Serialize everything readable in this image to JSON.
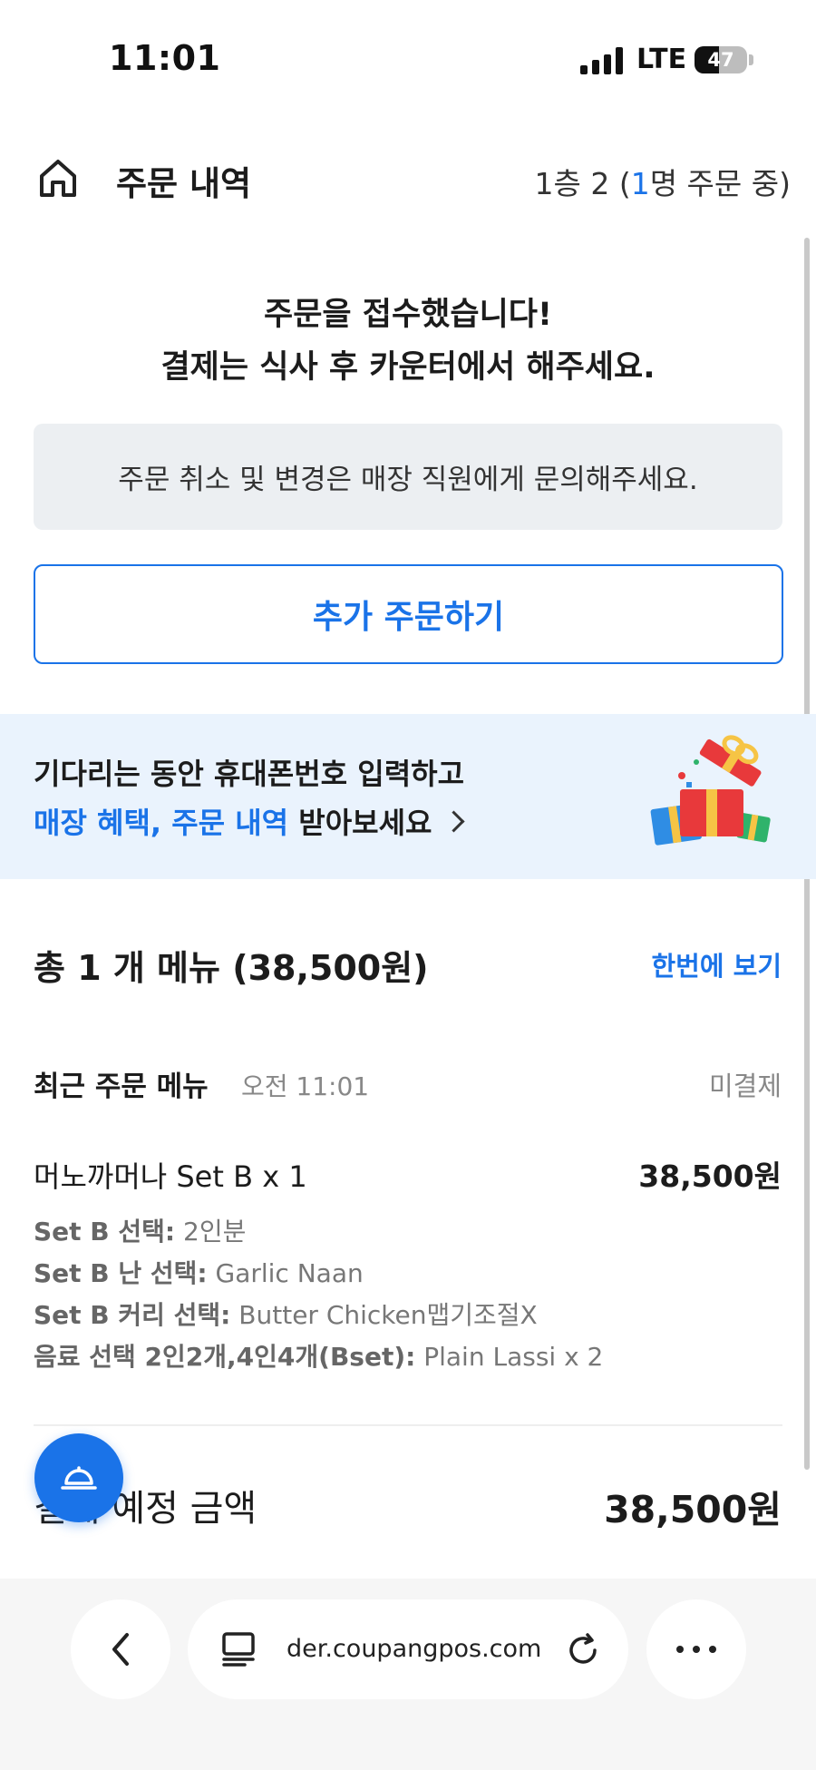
{
  "status_bar": {
    "time": "11:01",
    "network": "LTE",
    "battery": "47",
    "battery_level": 0.47
  },
  "header": {
    "home_icon": "home-icon",
    "title": "주문 내역",
    "table_prefix": "1층 2 (",
    "table_count": "1",
    "table_suffix": "명 주문 중)"
  },
  "confirmation": {
    "line1": "주문을 접수했습니다!",
    "line2": "결제는 식사 후 카운터에서 해주세요."
  },
  "notice": "주문 취소 및 변경은 매장 직원에게 문의해주세요.",
  "add_order_label": "추가 주문하기",
  "promo": {
    "line1": "기다리는 동안 휴대폰번호 입력하고",
    "line2_highlight": "매장 혜택, 주문 내역",
    "line2_rest": " 받아보세요",
    "icon": "gift-box-icon"
  },
  "summary": {
    "title": "총 1 개 메뉴 (38,500원)",
    "view_all": "한번에 보기"
  },
  "recent": {
    "label": "최근 주문 메뉴",
    "time": "오전 11:01",
    "status": "미결제"
  },
  "item": {
    "name": "머노까머나 Set B x 1",
    "price": "38,500원",
    "options": [
      {
        "label": "Set B 선택:",
        "value": " 2인분"
      },
      {
        "label": "Set B 난 선택:",
        "value": " Garlic Naan"
      },
      {
        "label": "Set B 커리 선택:",
        "value": " Butter Chicken맵기조절X"
      },
      {
        "label": "음료 선택 2인2개,4인4개(Bset):",
        "value": " Plain Lassi x 2"
      }
    ]
  },
  "total": {
    "label": "결제 예정 금액",
    "amount": "38,500원"
  },
  "fab_icon": "service-bell-icon",
  "browser": {
    "url": "der.coupangpos.com",
    "back_icon": "chevron-left-icon",
    "tabs_icon": "tabs-icon",
    "reload_icon": "reload-icon",
    "more_icon": "more-icon"
  },
  "colors": {
    "accent": "#1a73e8",
    "banner_bg": "#eaf3fd",
    "notice_bg": "#eceff2"
  }
}
